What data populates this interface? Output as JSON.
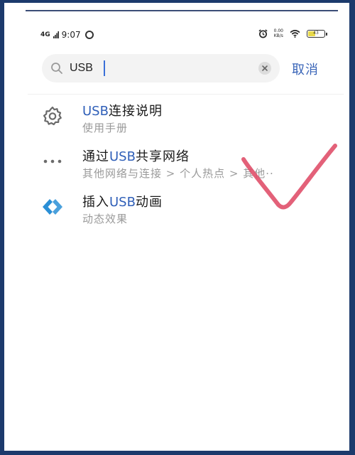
{
  "colors": {
    "frame": "#1c3a6c",
    "accent": "#2f5fb8",
    "cancel": "#3a65b8",
    "annotation": "#e0506a",
    "secondary_text": "#9a9a9a"
  },
  "status_bar": {
    "network": "4G",
    "time": "9:07",
    "speed_value": "0.00",
    "speed_unit": "KB/s",
    "battery_level": "43",
    "icons": [
      "signal-icon",
      "q-app-icon",
      "alarm-icon",
      "wifi-icon",
      "battery-icon"
    ]
  },
  "search": {
    "query": "USB",
    "clear_icon": "close-icon",
    "cancel_label": "取消"
  },
  "results": [
    {
      "icon": "gear-icon",
      "title_prefix": "",
      "title_highlight": "USB",
      "title_suffix": "连接说明",
      "subtitle": "使用手册"
    },
    {
      "icon": "more-dots-icon",
      "title_prefix": "通过",
      "title_highlight": "USB",
      "title_suffix": "共享网络",
      "subtitle": "其他网络与连接 > 个人热点 > 其他··"
    },
    {
      "icon": "diamond-icon",
      "title_prefix": "插入",
      "title_highlight": "USB",
      "title_suffix": "动画",
      "subtitle": "动态效果"
    }
  ]
}
